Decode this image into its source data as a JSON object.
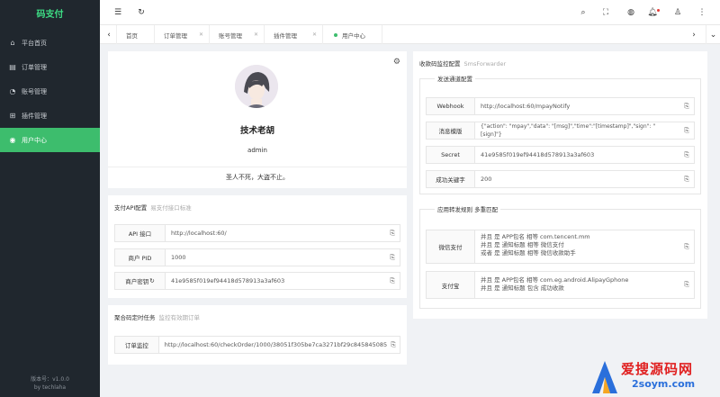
{
  "app": {
    "logo": "码支付",
    "version": "版本号：v1.0.0",
    "author": "by techlaha"
  },
  "sidebar": {
    "items": [
      {
        "label": "平台首页",
        "icon": "home-icon"
      },
      {
        "label": "订单管理",
        "icon": "order-icon"
      },
      {
        "label": "账号管理",
        "icon": "account-icon"
      },
      {
        "label": "插件管理",
        "icon": "plugin-icon"
      },
      {
        "label": "用户中心",
        "icon": "user-icon",
        "active": true
      }
    ]
  },
  "tabs": [
    {
      "label": "首页"
    },
    {
      "label": "订单管理"
    },
    {
      "label": "账号管理"
    },
    {
      "label": "插件管理"
    },
    {
      "label": "用户中心",
      "active": true
    }
  ],
  "profile": {
    "name": "技术老胡",
    "username": "admin",
    "motto": "圣人不死，大盗不止。"
  },
  "api_config": {
    "title": "支付API配置",
    "subtitle": "易支付接口标准",
    "rows": [
      {
        "label": "API 接口",
        "value": "http://localhost:60/"
      },
      {
        "label": "商户 PID",
        "value": "1000"
      },
      {
        "label": "商户密钥",
        "value": "41e9585f019ef94418d578913a3af603"
      }
    ]
  },
  "cron": {
    "title": "聚合码定时任务",
    "subtitle": "监控有效期订单",
    "rows": [
      {
        "label": "订单监控",
        "value": "http://localhost:60/checkOrder/1000/38051f305be7ca3271bf29c845845085"
      }
    ]
  },
  "monitor": {
    "title": "收款码监控配置",
    "subtitle": "SmsForwarder",
    "send_legend": "发送通道配置",
    "send_rows": [
      {
        "label": "Webhook",
        "value": "http://localhost:60/mpayNotify"
      },
      {
        "label": "消息模版",
        "value": "{\"action\": \"mpay\",\"data\": \"[msg]\",\"time\":\"[timestamp]\",\"sign\": \"[sign]\"}"
      },
      {
        "label": "Secret",
        "value": "41e9585f019ef94418d578913a3af603"
      },
      {
        "label": "成功关键字",
        "value": "200"
      }
    ],
    "rule_legend": "应用转发规则 多重匹配",
    "rules": [
      {
        "label": "微信支付",
        "lines": [
          "并且 是 APP包名 相等 com.tencent.mm",
          "并且 是 通知标题 相等 微信支付",
          "或者 是 通知标题 相等 微信收款助手"
        ]
      },
      {
        "label": "支付宝",
        "lines": [
          "并且 是 APP包名 相等 com.eg.android.AlipayGphone",
          "并且 是 通知标题 包含 成功收款"
        ]
      }
    ]
  },
  "watermark": {
    "text": "爱搜源码网",
    "sub": "2soym.com"
  }
}
